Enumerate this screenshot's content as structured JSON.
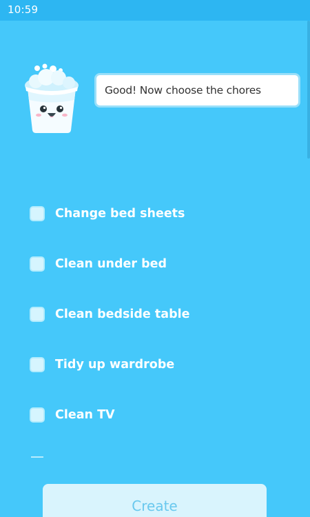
{
  "status_bar": {
    "time": "10:59"
  },
  "assistant": {
    "message": "Good! Now choose the chores",
    "mascot_icon": "smiling-bucket-icon"
  },
  "chores": [
    {
      "label": "Change bed sheets",
      "checked": false
    },
    {
      "label": "Clean under bed",
      "checked": false
    },
    {
      "label": "Clean bedside table",
      "checked": false
    },
    {
      "label": "Tidy up wardrobe",
      "checked": false
    },
    {
      "label": "Clean TV",
      "checked": false
    }
  ],
  "actions": {
    "create_label": "Create"
  },
  "colors": {
    "background": "#45C8FA",
    "status_bar": "#2DB6F2",
    "checkbox_fill": "#D6F5FE",
    "button_fill": "#D9F4FD",
    "button_text": "#69C8EE"
  }
}
